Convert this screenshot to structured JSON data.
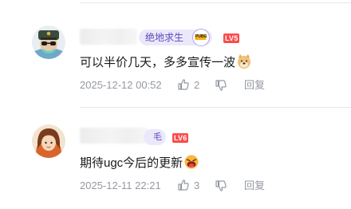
{
  "comments": [
    {
      "medal_name": "绝地求生",
      "medal_icon_text": "PUBG",
      "level": "LV5",
      "text": "可以半价几天，多多宣传一波",
      "timestamp": "2025-12-12 00:52",
      "likes": "2",
      "reply_label": "回复",
      "emoji": "doge-emoji"
    },
    {
      "medal_name": "毛",
      "level": "LV6",
      "text": "期待ugc今后的更新",
      "timestamp": "2025-12-11 22:21",
      "likes": "3",
      "reply_label": "回复",
      "emoji": "tongue-emoji"
    }
  ],
  "colors": {
    "level_badge": "#fb4b4b",
    "medal_bg": "#ece8fb",
    "medal_text": "#5b4ab8",
    "meta_text": "#9499a0",
    "body_text": "#18191c"
  }
}
